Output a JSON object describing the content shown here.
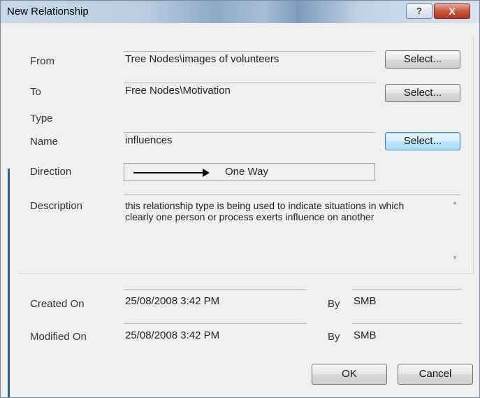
{
  "window": {
    "title": "New Relationship",
    "help_label": "?",
    "close_label": "X"
  },
  "form": {
    "from": {
      "label": "From",
      "value": "Tree Nodes\\images of volunteers",
      "select_label": "Select..."
    },
    "to": {
      "label": "To",
      "value": "Free Nodes\\Motivation",
      "select_label": "Select..."
    },
    "type_label": "Type",
    "name": {
      "label": "Name",
      "value": "influences",
      "select_label": "Select..."
    },
    "direction": {
      "label": "Direction",
      "value": "One Way",
      "icon": "right-arrow-icon"
    },
    "description": {
      "label": "Description",
      "value": "this relationship type is being used to indicate situations in which clearly one person or process exerts influence on another"
    },
    "created": {
      "label": "Created On",
      "value": "25/08/2008 3:42 PM",
      "by_label": "By",
      "by_value": "SMB"
    },
    "modified": {
      "label": "Modified On",
      "value": "25/08/2008 3:42 PM",
      "by_label": "By",
      "by_value": "SMB"
    }
  },
  "buttons": {
    "ok": "OK",
    "cancel": "Cancel"
  }
}
